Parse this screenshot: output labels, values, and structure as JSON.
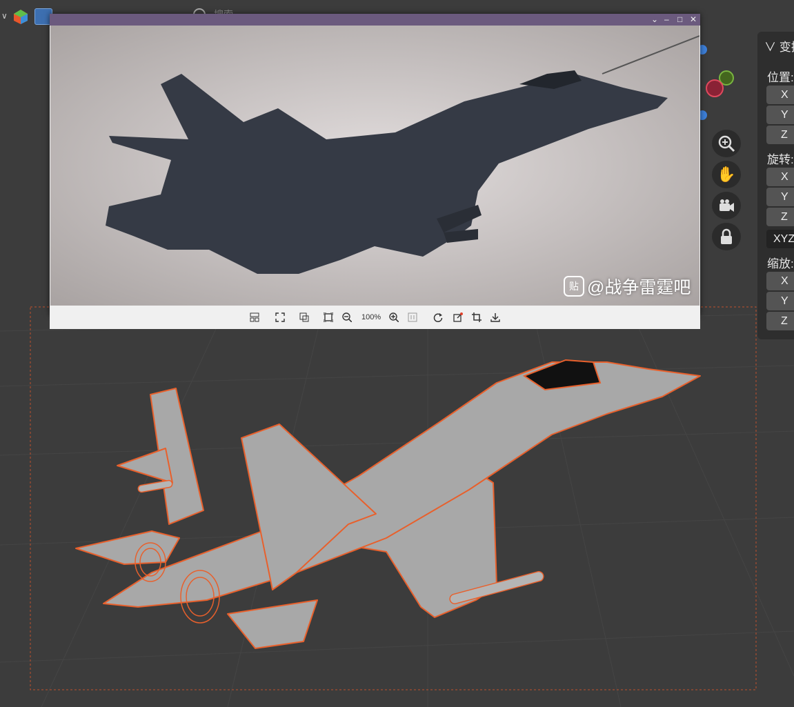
{
  "search": {
    "placeholder": "搜索"
  },
  "viewer": {
    "watermark": "@战争雷霆吧",
    "zoom": "100%"
  },
  "npanel": {
    "header": "变换",
    "location_label": "位置:",
    "rotation_label": "旋转:",
    "mode": "XYZ",
    "scale_label": "缩放:",
    "axes": [
      "X",
      "Y",
      "Z"
    ]
  },
  "colors": {
    "selection_outline": "#e8602c",
    "viewport_bg": "#3c3c3c",
    "panel_bg": "#2e2e2e",
    "titlebar": "#6b5a7e"
  }
}
